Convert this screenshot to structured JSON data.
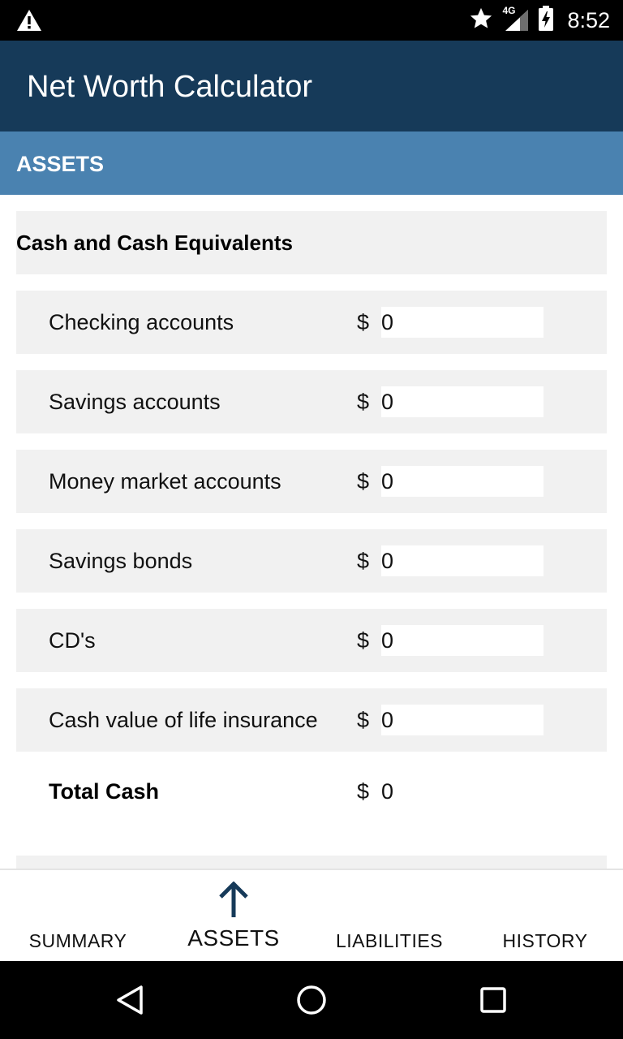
{
  "status_bar": {
    "time": "8:52",
    "network": "4G",
    "icons": [
      "warning-icon",
      "star-icon",
      "signal-icon",
      "battery-charging-icon"
    ]
  },
  "app_bar": {
    "title": "Net Worth Calculator"
  },
  "section": {
    "title": "ASSETS"
  },
  "group": {
    "title": "Cash and Cash Equivalents"
  },
  "rows": [
    {
      "label": "Checking accounts",
      "currency": "$",
      "value": "0"
    },
    {
      "label": "Savings accounts",
      "currency": "$",
      "value": "0"
    },
    {
      "label": "Money market accounts",
      "currency": "$",
      "value": "0"
    },
    {
      "label": "Savings bonds",
      "currency": "$",
      "value": "0"
    },
    {
      "label": "CD's",
      "currency": "$",
      "value": "0"
    },
    {
      "label": "Cash value of life insurance",
      "currency": "$",
      "value": "0"
    }
  ],
  "total": {
    "label": "Total Cash",
    "currency": "$",
    "value": "0"
  },
  "bottom_nav": {
    "tabs": [
      {
        "label": "SUMMARY",
        "active": false
      },
      {
        "label": "ASSETS",
        "active": true,
        "icon": "arrow-up-icon"
      },
      {
        "label": "LIABILITIES",
        "active": false
      },
      {
        "label": "HISTORY",
        "active": false
      }
    ]
  },
  "colors": {
    "app_bar": "#163a59",
    "section_bar": "#4a82b0",
    "row_background": "#f1f1f1",
    "active_icon": "#163a59"
  },
  "system_nav": {
    "icons": [
      "back-icon",
      "home-icon",
      "recents-icon"
    ]
  }
}
